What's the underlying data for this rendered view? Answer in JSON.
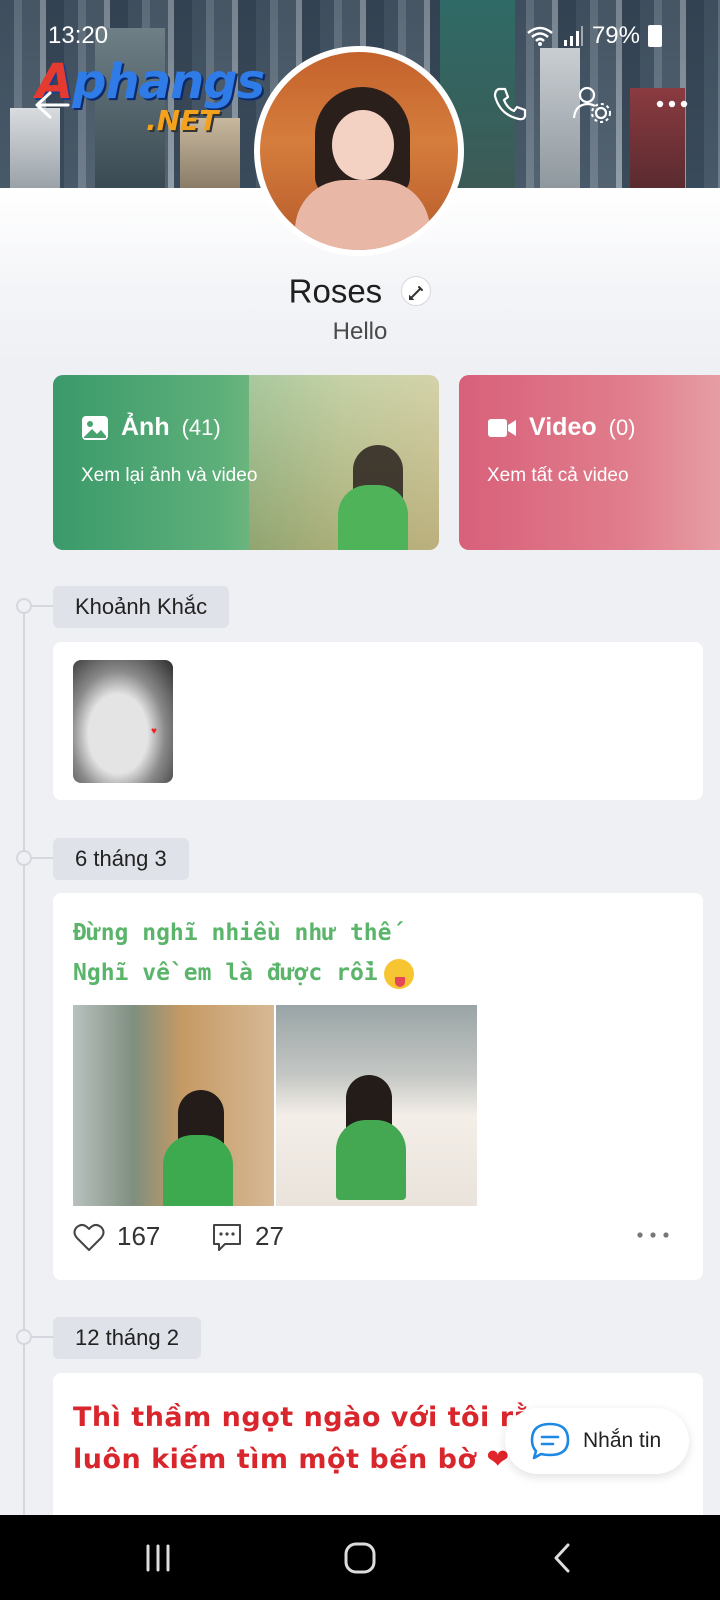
{
  "status_bar": {
    "time": "13:20",
    "battery": "79%"
  },
  "watermark": {
    "part1": "A",
    "part2": "phangs",
    "net": ".NET"
  },
  "profile": {
    "name": "Roses",
    "status": "Hello"
  },
  "media": {
    "photos": {
      "title": "Ảnh",
      "count": "(41)",
      "subtitle": "Xem lại ảnh và video"
    },
    "videos": {
      "title": "Video",
      "count": "(0)",
      "subtitle": "Xem tất cả video"
    }
  },
  "timeline": {
    "moments_label": "Khoảnh Khắc",
    "posts": [
      {
        "date": "6 tháng 3",
        "text_line1": "Đừng nghĩ nhiều như thế",
        "text_line2": "Nghĩ về em là được rồi",
        "likes": "167",
        "comments": "27"
      },
      {
        "date": "12 tháng 2",
        "text_line1": "Thì thầm ngọt ngào với tôi rằng",
        "text_line2": "luôn kiếm tìm một bến bờ"
      }
    ]
  },
  "chat_button": {
    "label": "Nhắn tin"
  },
  "colors": {
    "photo_card": "#3a9a6a",
    "video_card": "#d8607a",
    "post1_text": "#5ab56a",
    "post2_text": "#d9262c",
    "chat_icon": "#1e88e5"
  },
  "icons": {
    "back": "arrow-left-icon",
    "call": "phone-icon",
    "settings": "user-settings-icon",
    "more": "more-dots-icon",
    "edit": "pencil-icon",
    "photo": "image-icon",
    "video": "video-camera-icon",
    "like": "heart-icon",
    "comment": "comment-icon",
    "chat": "chat-bubble-icon"
  }
}
